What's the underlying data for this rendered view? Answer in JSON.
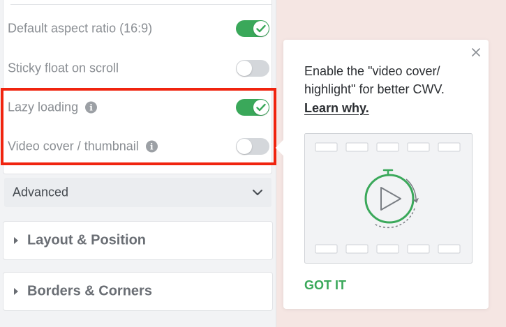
{
  "settings": {
    "rows": [
      {
        "label": "Default aspect ratio (16:9)",
        "enabled": true,
        "has_info": false
      },
      {
        "label": "Sticky float on scroll",
        "enabled": false,
        "has_info": false
      },
      {
        "label": "Lazy loading",
        "enabled": true,
        "has_info": true
      },
      {
        "label": "Video cover / thumbnail",
        "enabled": false,
        "has_info": true
      }
    ],
    "info_glyph": "i"
  },
  "advanced": {
    "label": "Advanced",
    "icon": "chevron-down-icon"
  },
  "panels": [
    {
      "label": "Layout & Position",
      "icon": "caret-right-icon"
    },
    {
      "label": "Borders & Corners",
      "icon": "caret-right-icon"
    }
  ],
  "popover": {
    "message": "Enable the \"video cover/ highlight\" for better CWV.",
    "link_label": "Learn why.",
    "button_label": "GOT IT",
    "close_icon": "close-icon",
    "illustration_icon": "video-timer-icon"
  },
  "colors": {
    "accent_green": "#3aa85a",
    "highlight_red": "#f0240f",
    "page_background": "#f5e6e3"
  }
}
